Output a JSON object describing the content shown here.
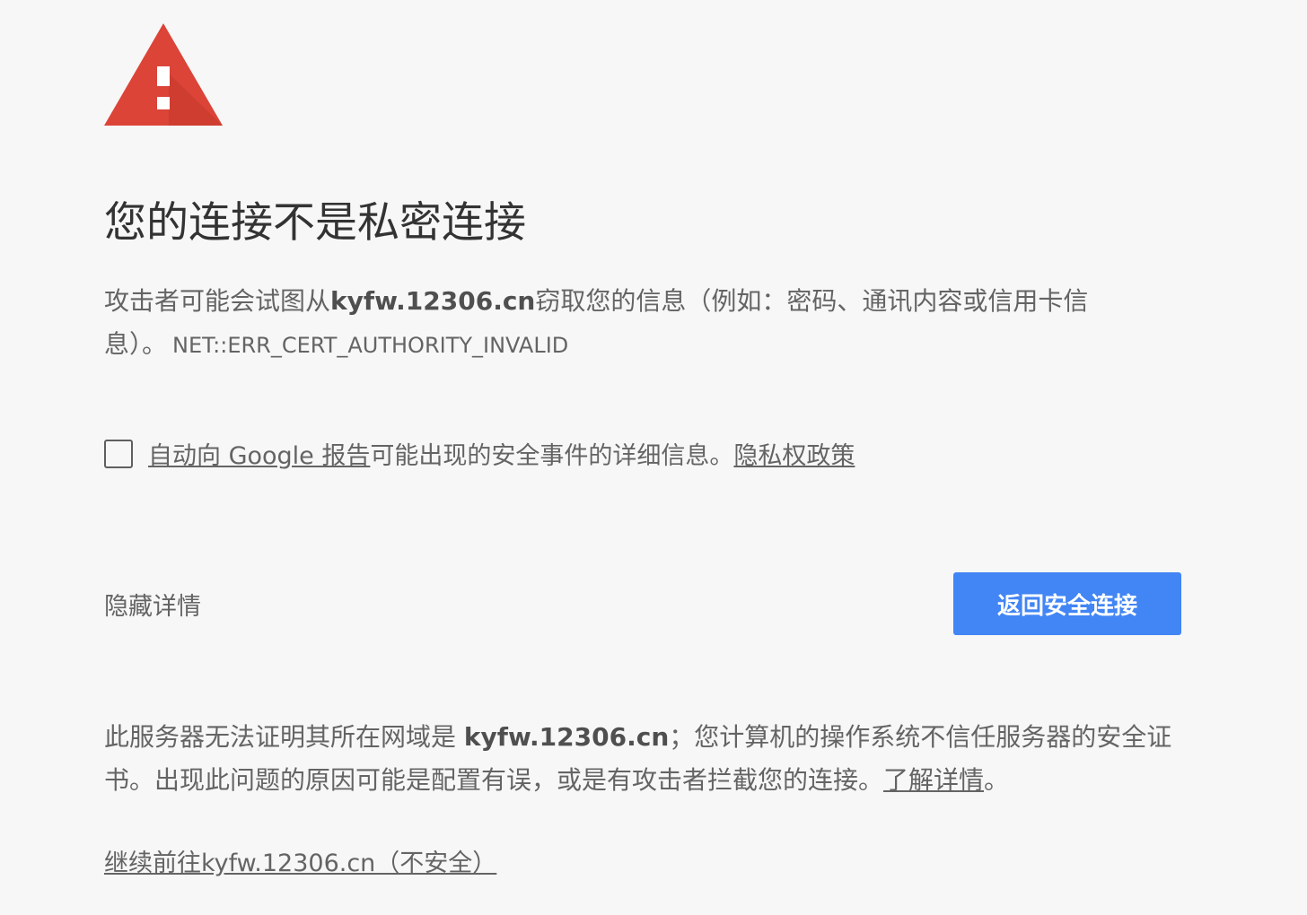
{
  "colors": {
    "background": "#f7f7f7",
    "warning_red": "#db4437",
    "primary_blue": "#4285f4",
    "text": "#646464",
    "title": "#333333"
  },
  "icon": {
    "name": "warning-triangle-icon"
  },
  "title": "您的连接不是私密连接",
  "message": {
    "before": "攻击者可能会试图从",
    "host": "kyfw.12306.cn",
    "after": "窃取您的信息（例如：密码、通讯内容或信用卡信息）。",
    "error_code": "NET::ERR_CERT_AUTHORITY_INVALID"
  },
  "report": {
    "checked": false,
    "link_text": "自动向 Google 报告",
    "text": "可能出现的安全事件的详细信息。",
    "privacy_link": "隐私权政策"
  },
  "buttons": {
    "hide_details": "隐藏详情",
    "back_to_safety": "返回安全连接"
  },
  "details": {
    "before": "此服务器无法证明其所在网域是 ",
    "host": "kyfw.12306.cn",
    "after": "；您计算机的操作系统不信任服务器的安全证书。出现此问题的原因可能是配置有误，或是有攻击者拦截您的连接。",
    "learn_more": "了解详情",
    "end": "。"
  },
  "proceed_link": "继续前往kyfw.12306.cn（不安全）"
}
